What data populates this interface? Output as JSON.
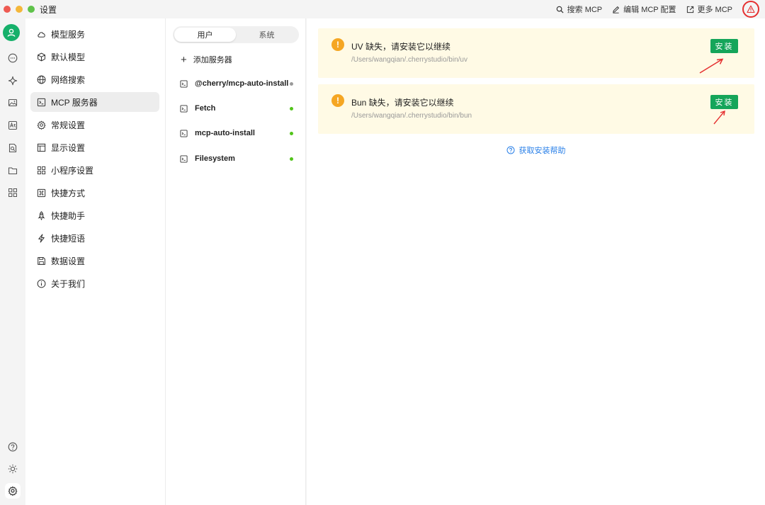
{
  "window": {
    "title": "设置"
  },
  "toolbar": {
    "search_label": "搜索 MCP",
    "edit_label": "编辑 MCP 配置",
    "more_label": "更多 MCP"
  },
  "menu": {
    "items": [
      {
        "label": "模型服务",
        "icon": "cloud-icon"
      },
      {
        "label": "默认模型",
        "icon": "cube-icon"
      },
      {
        "label": "网络搜索",
        "icon": "globe-icon"
      },
      {
        "label": "MCP 服务器",
        "icon": "terminal-icon",
        "active": true
      },
      {
        "label": "常规设置",
        "icon": "gear-icon"
      },
      {
        "label": "显示设置",
        "icon": "layout-icon"
      },
      {
        "label": "小程序设置",
        "icon": "grid-icon"
      },
      {
        "label": "快捷方式",
        "icon": "command-icon"
      },
      {
        "label": "快捷助手",
        "icon": "rocket-icon"
      },
      {
        "label": "快捷短语",
        "icon": "bolt-icon"
      },
      {
        "label": "数据设置",
        "icon": "save-icon"
      },
      {
        "label": "关于我们",
        "icon": "info-icon"
      }
    ]
  },
  "servers": {
    "tabs": [
      "用户",
      "系统"
    ],
    "add_label": "添加服务器",
    "list": [
      {
        "name": "@cherry/mcp-auto-install",
        "status_color": "#9a9a9a"
      },
      {
        "name": "Fetch",
        "status_color": "#52c41a"
      },
      {
        "name": "mcp-auto-install",
        "status_color": "#52c41a"
      },
      {
        "name": "Filesystem",
        "status_color": "#52c41a"
      }
    ]
  },
  "alerts": [
    {
      "title": "UV 缺失，请安装它以继续",
      "path": "/Users/wangqian/.cherrystudio/bin/uv",
      "button": "安装"
    },
    {
      "title": "Bun 缺失，请安装它以继续",
      "path": "/Users/wangqian/.cherrystudio/bin/bun",
      "button": "安装"
    }
  ],
  "help_label": "获取安装帮助",
  "colors": {
    "accent": "#15a55a",
    "warning": "#f5a623",
    "link": "#2a80e8",
    "alert_bg": "#fffae5"
  }
}
